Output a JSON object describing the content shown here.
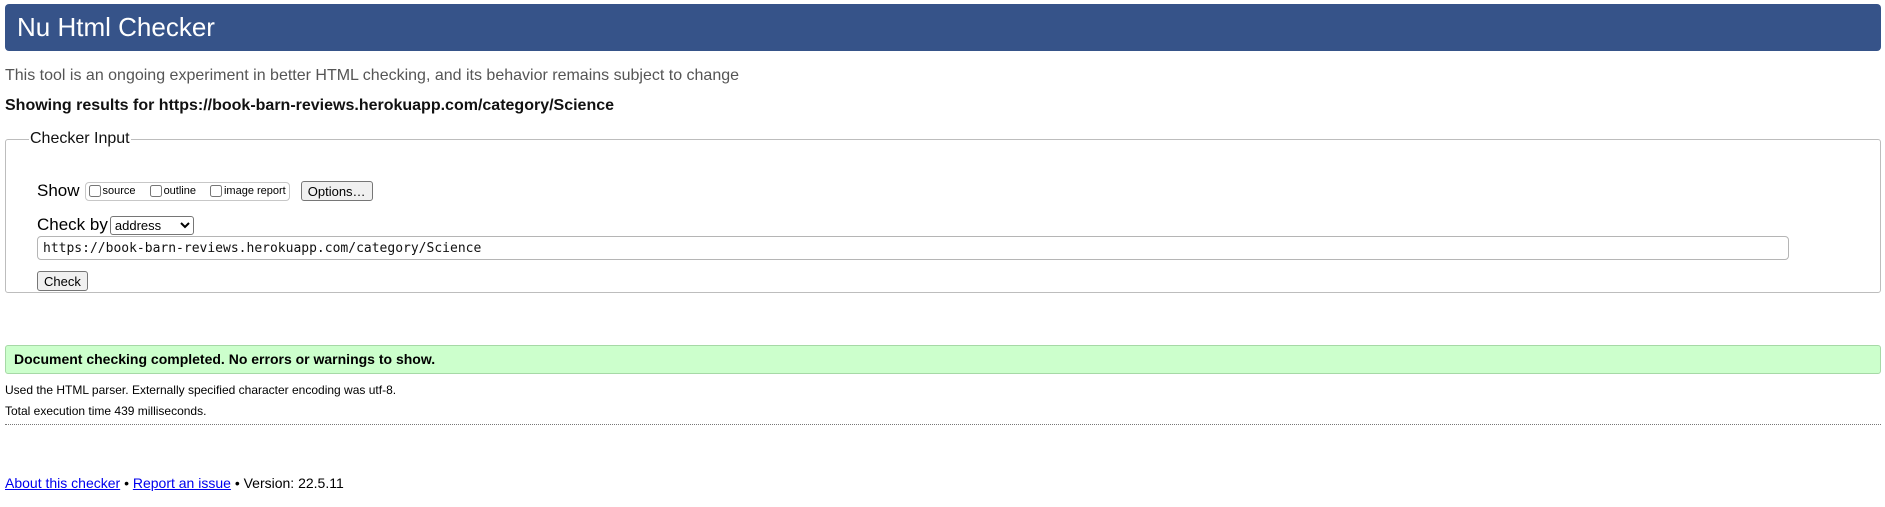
{
  "header": {
    "title": "Nu Html Checker"
  },
  "tagline": "This tool is an ongoing experiment in better HTML checking, and its behavior remains subject to change",
  "showing_results": "Showing results for https://book-barn-reviews.herokuapp.com/category/Science",
  "checker_input": {
    "legend": "Checker Input",
    "show_label": "Show",
    "show_options": [
      {
        "label": "source",
        "checked": false
      },
      {
        "label": "outline",
        "checked": false
      },
      {
        "label": "image report",
        "checked": false
      }
    ],
    "options_button": "Options…",
    "check_by_label": "Check by",
    "check_by_value": "address",
    "url_value": "https://book-barn-reviews.herokuapp.com/category/Science",
    "check_button": "Check"
  },
  "result": {
    "success_message": "Document checking completed. No errors or warnings to show.",
    "parser_info": "Used the HTML parser. Externally specified character encoding was utf-8.",
    "execution_time": "Total execution time 439 milliseconds."
  },
  "footer": {
    "about_link": "About this checker",
    "separator": "•",
    "report_link": "Report an issue",
    "version": "Version: 22.5.11"
  },
  "colors": {
    "header_bg": "#365389",
    "success_bg": "#ccffcc",
    "link": "#0000ee"
  }
}
